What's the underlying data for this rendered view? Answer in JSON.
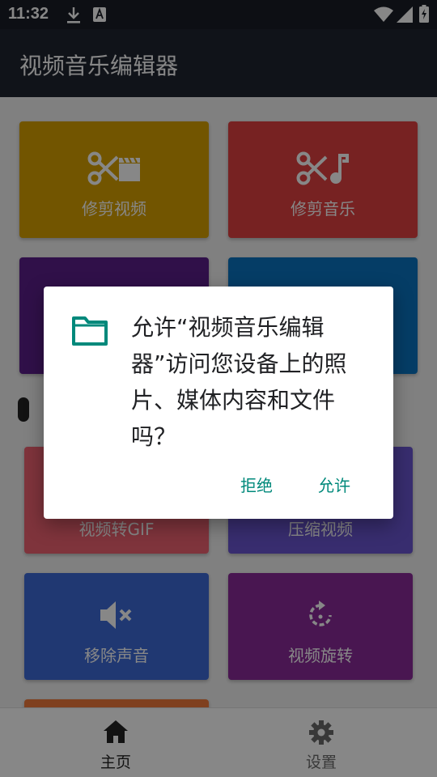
{
  "status_bar": {
    "time": "11:32",
    "icons": [
      "download-icon",
      "text-a-icon",
      "wifi-icon",
      "signal-icon",
      "battery-icon"
    ]
  },
  "app_bar": {
    "title": "视频音乐编辑器"
  },
  "tiles": [
    {
      "label": "修剪视频",
      "icon": "scissors-clapper-icon",
      "color": "#d8a100"
    },
    {
      "label": "修剪音乐",
      "icon": "scissors-note-icon",
      "color": "#e04040"
    },
    {
      "label": "",
      "color": "#5b1f8a"
    },
    {
      "label": "",
      "color": "#0b74c0"
    },
    {
      "label": "视频转GIF",
      "color": "#f06272"
    },
    {
      "label": "压缩视频",
      "color": "#6b55d1"
    },
    {
      "label": "移除声音",
      "icon": "mute-icon",
      "color": "#3e6ad8"
    },
    {
      "label": "视频旋转",
      "icon": "rotate-icon",
      "color": "#8a2b9a"
    },
    {
      "label": "",
      "color": "#f07a3c"
    }
  ],
  "bottom_nav": {
    "home": {
      "label": "主页",
      "icon": "home-icon",
      "color": "#222222"
    },
    "settings": {
      "label": "设置",
      "icon": "gear-icon",
      "color": "#6b6b6b"
    }
  },
  "dialog": {
    "icon": "folder-icon",
    "message": "允许“视频音乐编辑器”访问您设备上的照片、媒体内容和文件吗？",
    "deny_label": "拒绝",
    "allow_label": "允许",
    "accent_color": "#00897b"
  }
}
